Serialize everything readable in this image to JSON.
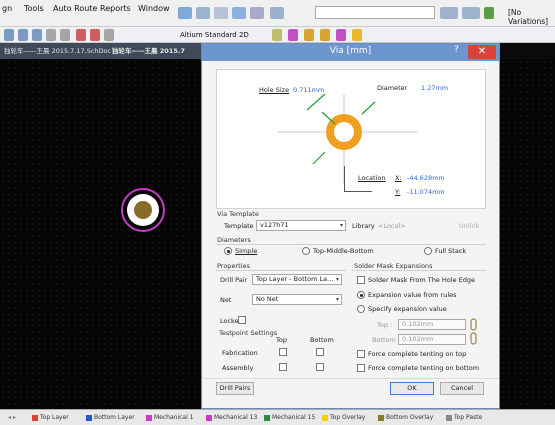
{
  "menu": {
    "tools": "Tools",
    "auto_route": "Auto Route",
    "reports": "Reports",
    "window": "Window",
    "variations": "[No Variations]"
  },
  "toolbar": {
    "view_mode": "Altium Standard 2D"
  },
  "doc_tabs": [
    {
      "label": "独轮车——王晨 2015.7.17.SchDoc"
    },
    {
      "label": "独轮车——王晨 2015.7"
    }
  ],
  "dialog": {
    "title": "Via [mm]",
    "help": "?",
    "close": "✕",
    "preview": {
      "hole_size_label": "Hole Size",
      "hole_size_value": "0.711mm",
      "diameter_label": "Diameter",
      "diameter_value": "1.27mm",
      "location_label": "Location",
      "x_label": "X:",
      "x_value": "-44.628mm",
      "y_label": "Y:",
      "y_value": "-11.074mm"
    },
    "via_template": {
      "group_label": "Via Template",
      "template_label": "Template",
      "template_value": "v127h71",
      "library_label": "Library",
      "library_value": "<Local>",
      "unlink_label": "Unlink"
    },
    "diameters": {
      "group_label": "Diameters",
      "simple": "Simple",
      "top_middle_bottom": "Top-Middle-Bottom",
      "full_stack": "Full Stack",
      "selected": "Simple"
    },
    "properties": {
      "group_label": "Properties",
      "drill_pair_label": "Drill Pair",
      "drill_pair_value": "Top Layer - Bottom La...",
      "net_label": "Net",
      "net_value": "No Net",
      "locked_label": "Locked",
      "testpoint_label": "Testpoint Settings",
      "top_col": "Top",
      "bottom_col": "Bottom",
      "fabrication": "Fabrication",
      "assembly": "Assembly"
    },
    "solder_mask": {
      "group_label": "Solder Mask Expansions",
      "from_hole_edge": "Solder Mask From The Hole Edge",
      "expansion_from_rules": "Expansion value from rules",
      "specify_expansion": "Specify expansion value",
      "top_label": "Top :",
      "top_value": "0.102mm",
      "bottom_label": "Bottom :",
      "bottom_value": "0.102mm",
      "force_top": "Force complete tenting on top",
      "force_bottom": "Force complete tenting on bottom"
    },
    "buttons": {
      "drill_pairs": "Drill Pairs",
      "ok": "OK",
      "cancel": "Cancel"
    }
  },
  "layers": [
    {
      "name": "Top Layer",
      "color": "#e23c3c"
    },
    {
      "name": "Bottom Layer",
      "color": "#2d54c8"
    },
    {
      "name": "Mechanical 1",
      "color": "#c43cc4"
    },
    {
      "name": "Mechanical 13",
      "color": "#c43cc4"
    },
    {
      "name": "Mechanical 15",
      "color": "#2e8a3a"
    },
    {
      "name": "Top Overlay",
      "color": "#f0d000"
    },
    {
      "name": "Bottom Overlay",
      "color": "#8a7a20"
    },
    {
      "name": "Top Paste",
      "color": "#888888"
    }
  ],
  "colors": {
    "title_bar": "#6d96cf",
    "via_copper": "#f0a020",
    "value_text": "#2f6ad2"
  }
}
